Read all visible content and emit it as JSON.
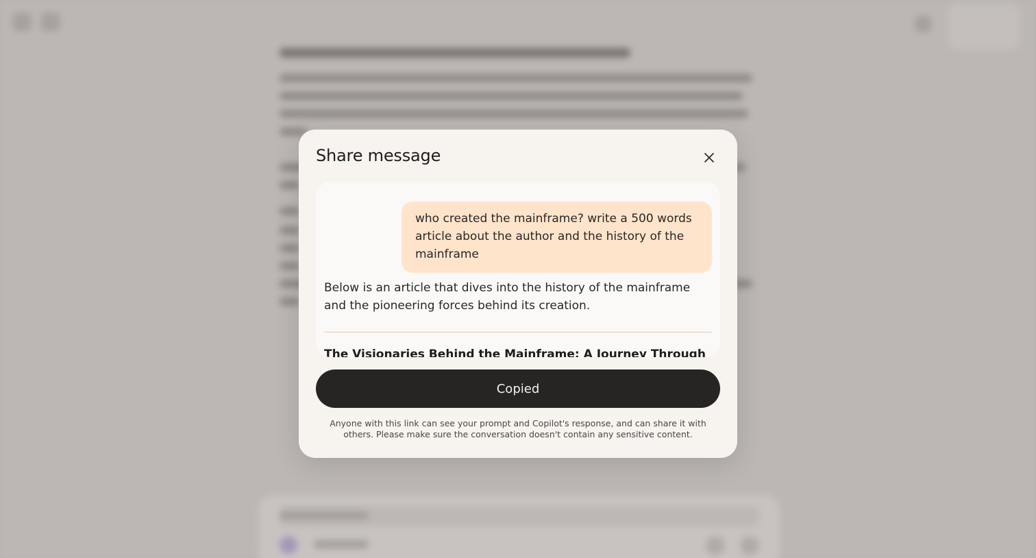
{
  "modal": {
    "title": "Share message",
    "close_icon": "close-icon",
    "preview": {
      "user_prompt": "who created the mainframe? write a 500 words article about the author and the history of the mainframe",
      "assistant_intro": "Below is an article that dives into the history of the mainframe and the pioneering forces behind its creation.",
      "article_title": "The Visionaries Behind the Mainframe: A Journey Through"
    },
    "copy_button_label": "Copied",
    "disclaimer": "Anyone with this link can see your prompt and Copilot's response, and can share it with others. Please make sure the conversation doesn't contain any sensitive content."
  },
  "colors": {
    "overlay": "#b9b4b2",
    "modal_bg": "#f7f3ef",
    "user_bubble": "#ffe4cc",
    "button_bg": "#272523",
    "button_text": "#f3efeb"
  }
}
